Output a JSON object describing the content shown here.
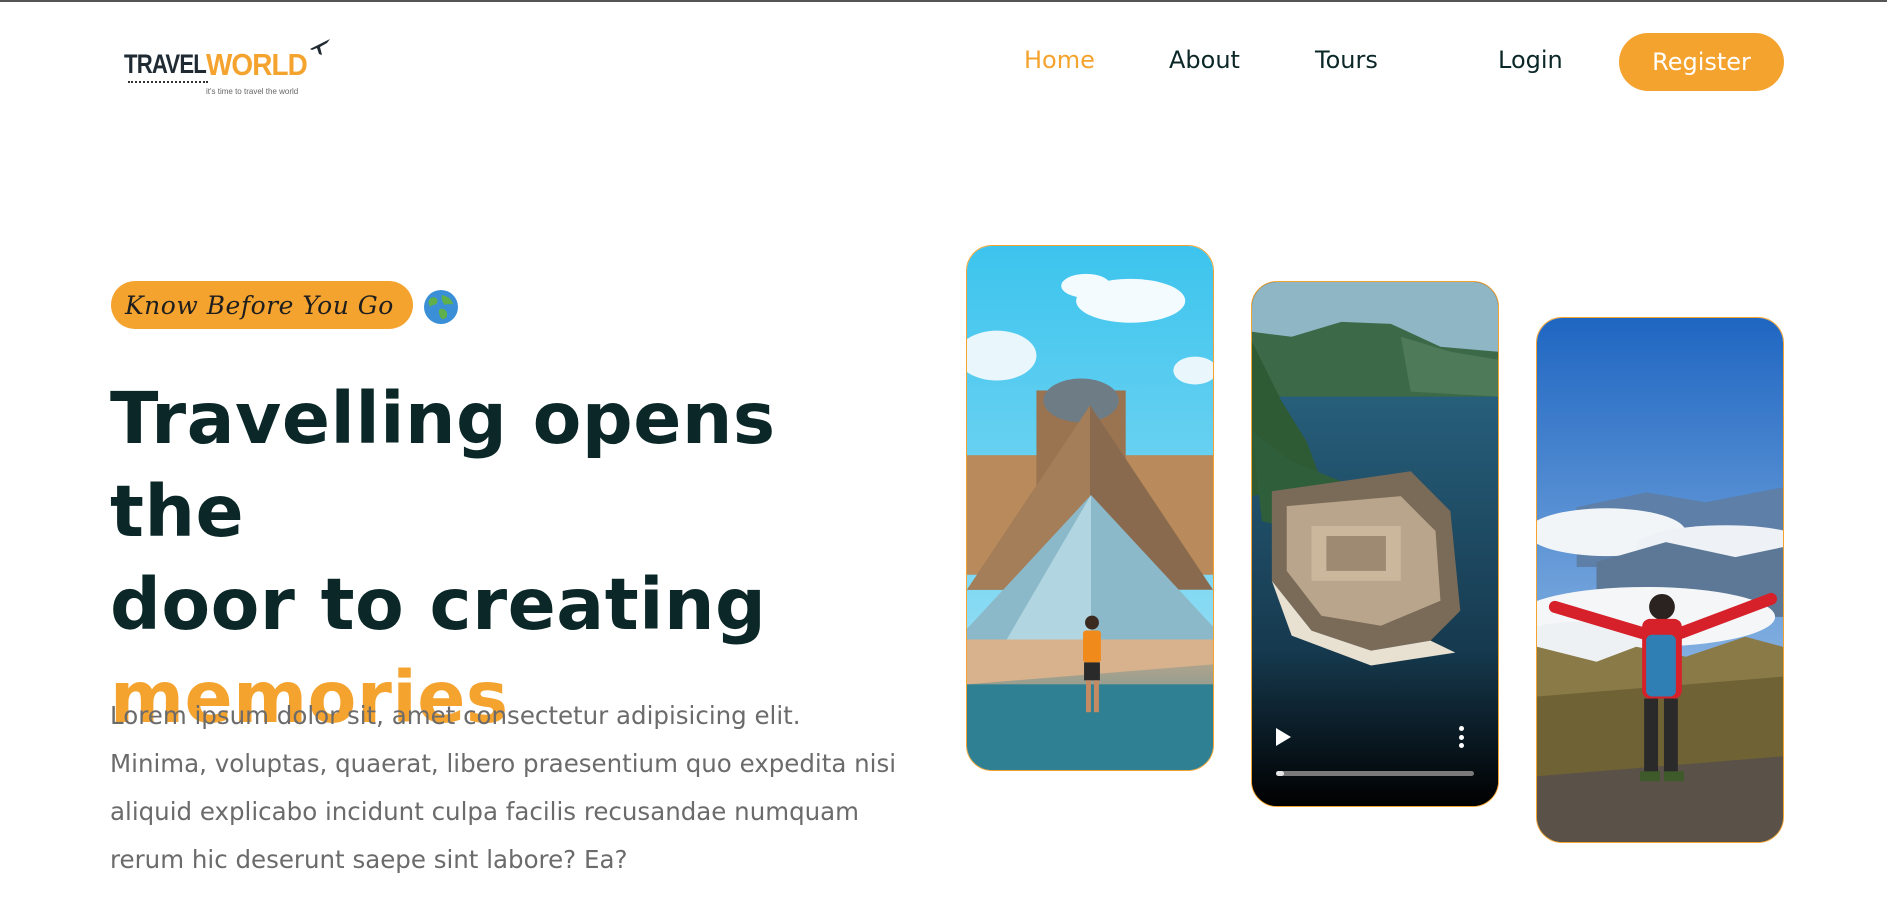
{
  "brand": {
    "logo_part1": "TRAVEL",
    "logo_part2": "WORLD",
    "tagline": "it's time to travel the world"
  },
  "nav": {
    "items": [
      {
        "label": "Home",
        "active": true
      },
      {
        "label": "About",
        "active": false
      },
      {
        "label": "Tours",
        "active": false
      }
    ],
    "login_label": "Login",
    "register_label": "Register"
  },
  "hero": {
    "subtitle": "Know Before You Go",
    "subtitle_icon": "globe-icon",
    "headline_line1": "Travelling opens the",
    "headline_line2": "door to creating",
    "headline_accent": "memories",
    "description": "Lorem ipsum dolor sit, amet consectetur adipisicing elit. Minima, voluptas, quaerat, libero praesentium quo expedita nisi aliquid explicabo incidunt culpa facilis recusandae numquam rerum hic deserunt saepe sint labore? Ea?"
  },
  "media": {
    "video_progress_percent": 4
  },
  "colors": {
    "accent": "#f5a32f",
    "heading": "#0b2727",
    "text_muted": "#6b6b6b"
  }
}
